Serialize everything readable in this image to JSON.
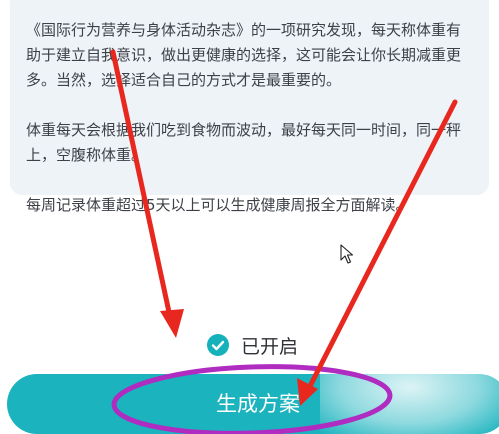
{
  "info_card": {
    "paragraph_1": "《国际行为营养与身体活动杂志》的一项研究发现，每天称体重有助于建立自我意识，做出更健康的选择，这可能会让你长期减重更多。当然，选择适合自己的方式才是最重要的。",
    "paragraph_2": "体重每天会根据我们吃到食物而波动，最好每天同一时间，同一秤上，空腹称体重。",
    "paragraph_3": "每周记录体重超过5天以上可以生成健康周报全方面解读。"
  },
  "status": {
    "label": "已开启",
    "icon": "check-circle-icon"
  },
  "action": {
    "generate_label": "生成方案"
  },
  "colors": {
    "accent": "#1ab3be",
    "annotation_red": "#e8281f",
    "annotation_magenta": "#b02bc0",
    "card_background": "#eef3f8"
  }
}
